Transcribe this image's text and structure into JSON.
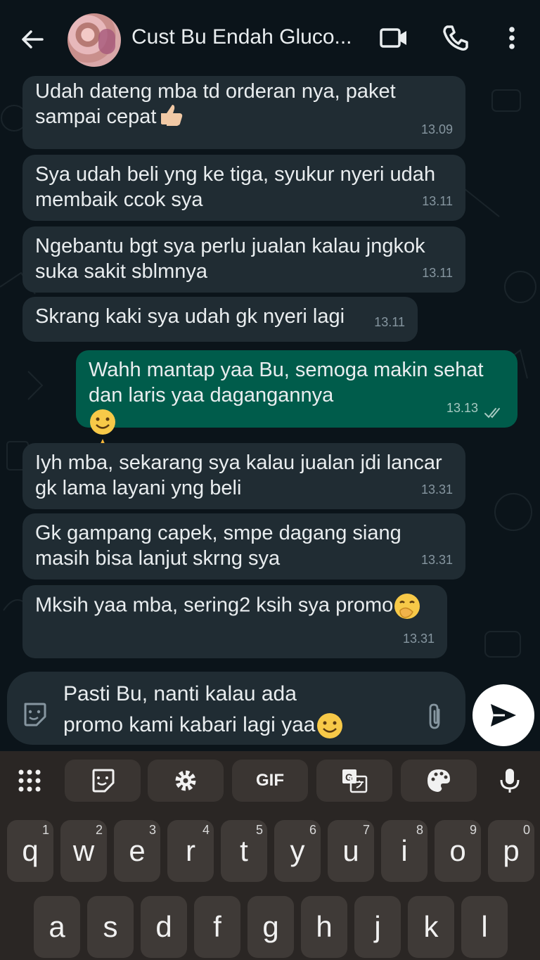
{
  "header": {
    "title": "Cust Bu Endah Gluco...",
    "icons": [
      "back-arrow-icon",
      "video-call-icon",
      "phone-icon",
      "more-vertical-icon"
    ]
  },
  "messages": [
    {
      "dir": "in",
      "text": "Udah dateng mba td orderan nya, paket\nsampai cepat",
      "emoji": "thumbs-up",
      "time": "13.09"
    },
    {
      "dir": "in",
      "text": "Sya udah beli yng ke tiga, syukur nyeri udah\nmembaik ccok sya",
      "time": "13.11"
    },
    {
      "dir": "in",
      "text": "Ngebantu bgt sya perlu jualan kalau jngkok\nsuka sakit sblmnya",
      "time": "13.11"
    },
    {
      "dir": "in",
      "text": "Skrang kaki sya udah gk nyeri lagi",
      "time": "13.11"
    },
    {
      "dir": "out",
      "text": "Wahh mantap yaa Bu, semoga makin sehat\ndan laris yaa dagangannya",
      "emoji": "smile, pray",
      "time": "13.13",
      "status": "read"
    },
    {
      "dir": "in",
      "text": "Iyh mba, sekarang sya kalau jualan jdi lancar\ngk lama layani yng beli",
      "time": "13.31"
    },
    {
      "dir": "in",
      "text": "Gk gampang capek, smpe dagang siang\nmasih bisa lanjut skrng sya",
      "time": "13.31"
    },
    {
      "dir": "in",
      "text": "Mksih yaa mba, sering2 ksih sya promo",
      "emoji": "hand-over-mouth",
      "time": "13.31"
    }
  ],
  "composer": {
    "text": "Pasti Bu, nanti kalau ada\npromo kami kabari lagi yaa",
    "emoji": "smile"
  },
  "keyboard": {
    "toolbar": [
      "apps-grid-icon",
      "sticker-icon",
      "settings-icon",
      "GIF",
      "translate-icon",
      "palette-icon",
      "mic-icon"
    ],
    "row1": [
      {
        "key": "q",
        "hint": "1"
      },
      {
        "key": "w",
        "hint": "2"
      },
      {
        "key": "e",
        "hint": "3"
      },
      {
        "key": "r",
        "hint": "4"
      },
      {
        "key": "t",
        "hint": "5"
      },
      {
        "key": "y",
        "hint": "6"
      },
      {
        "key": "u",
        "hint": "7"
      },
      {
        "key": "i",
        "hint": "8"
      },
      {
        "key": "o",
        "hint": "9"
      },
      {
        "key": "p",
        "hint": "0"
      }
    ],
    "row2": [
      "a",
      "s",
      "d",
      "f",
      "g",
      "h",
      "j",
      "k",
      "l"
    ]
  },
  "colors": {
    "background": "#0b141a",
    "incoming_bubble": "#202c33",
    "outgoing_bubble": "#005c4b",
    "keyboard_bg": "#2a2624"
  }
}
